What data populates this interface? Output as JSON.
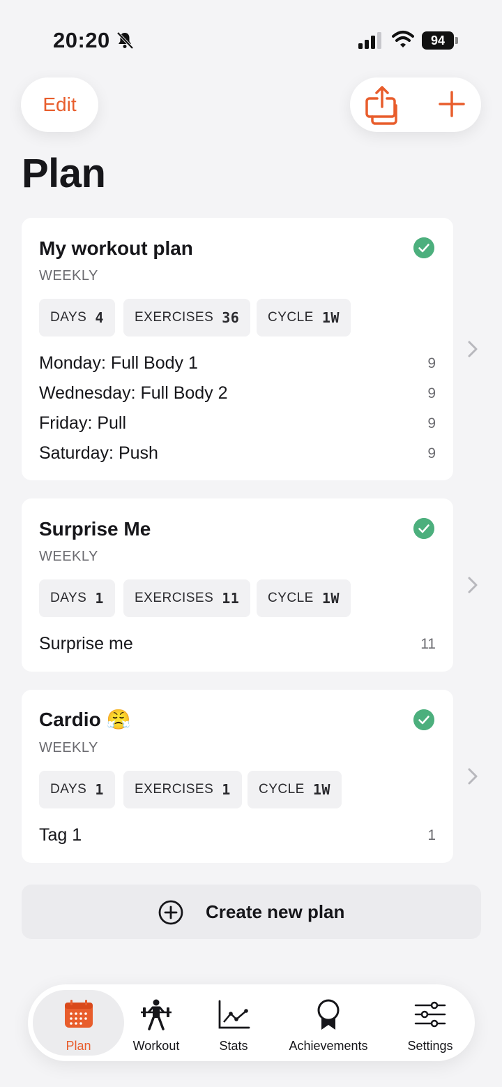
{
  "status_bar": {
    "time": "20:20",
    "battery": "94"
  },
  "header": {
    "edit_label": "Edit",
    "title": "Plan"
  },
  "plans": [
    {
      "title": "My workout plan",
      "subtitle": "WEEKLY",
      "chips": [
        {
          "label": "DAYS",
          "value": "4"
        },
        {
          "label": "EXERCISES",
          "value": "36"
        },
        {
          "label": "CYCLE",
          "value": "1W"
        }
      ],
      "rows": [
        {
          "label": "Monday: Full Body 1",
          "count": "9"
        },
        {
          "label": "Wednesday: Full Body 2",
          "count": "9"
        },
        {
          "label": "Friday: Pull",
          "count": "9"
        },
        {
          "label": "Saturday: Push",
          "count": "9"
        }
      ]
    },
    {
      "title": "Surprise Me",
      "subtitle": "WEEKLY",
      "chips": [
        {
          "label": "DAYS",
          "value": "1"
        },
        {
          "label": "EXERCISES",
          "value": "11"
        },
        {
          "label": "CYCLE",
          "value": "1W"
        }
      ],
      "rows": [
        {
          "label": "Surprise me",
          "count": "11"
        }
      ]
    },
    {
      "title": "Cardio 😤",
      "subtitle": "WEEKLY",
      "chips": [
        {
          "label": "DAYS",
          "value": "1"
        },
        {
          "label": "EXERCISES",
          "value": "1"
        },
        {
          "label": "CYCLE",
          "value": "1W"
        }
      ],
      "rows": [
        {
          "label": "Tag 1",
          "count": "1"
        }
      ]
    }
  ],
  "create_plan_label": "Create new plan",
  "tabs": [
    {
      "label": "Plan",
      "icon": "calendar-icon",
      "active": true
    },
    {
      "label": "Workout",
      "icon": "weightlifter-icon",
      "active": false
    },
    {
      "label": "Stats",
      "icon": "line-chart-icon",
      "active": false
    },
    {
      "label": "Achievements",
      "icon": "award-ribbon-icon",
      "active": false
    },
    {
      "label": "Settings",
      "icon": "sliders-icon",
      "active": false
    }
  ],
  "colors": {
    "accent": "#e85d2c",
    "check": "#4caf7d",
    "background": "#f4f4f6"
  }
}
